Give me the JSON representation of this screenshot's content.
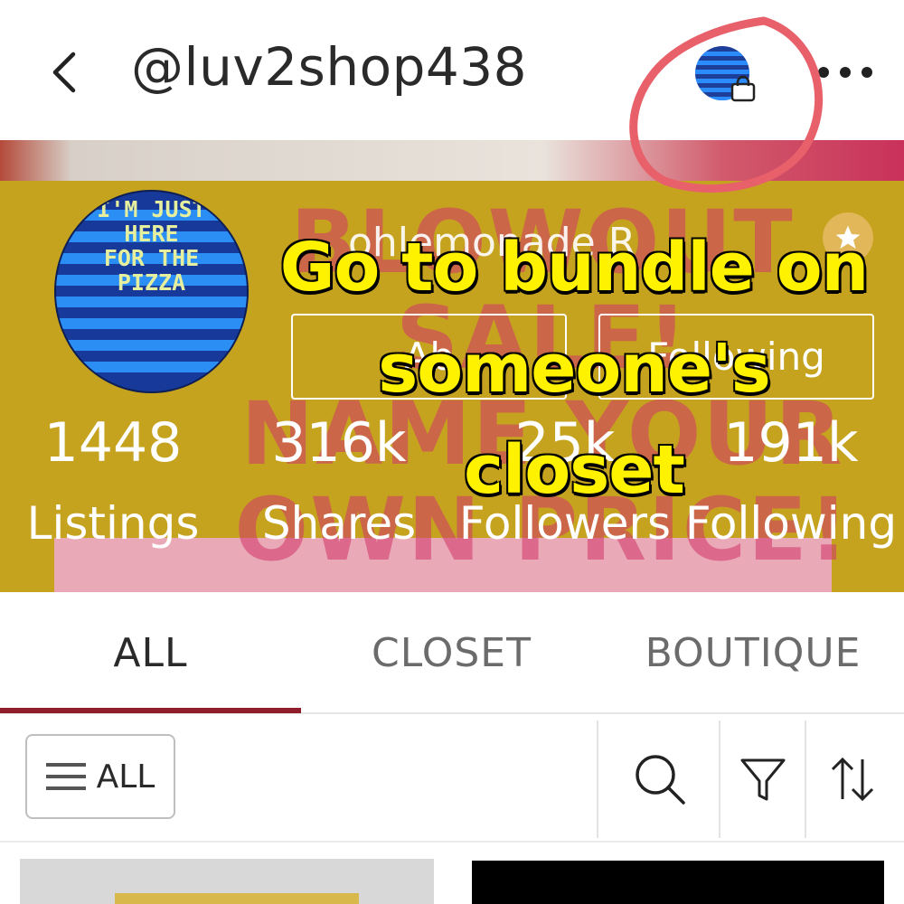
{
  "header": {
    "username": "@luv2shop438",
    "bundle_avatar_text": "I'M JUST HERE FOR THE PIZZA",
    "icons": {
      "back": "chevron-left-icon",
      "bag": "shopping-bag-icon",
      "more": "more-horizontal-icon"
    }
  },
  "banner": {
    "title_lines": [
      "BLOWOUT SALE!",
      "NAME YOUR",
      "OWN PRICE!"
    ],
    "avatar_text": [
      "I'M JUST",
      "HERE",
      "FOR THE",
      "PIZZA"
    ],
    "display_name": "ohlemonade R",
    "left_button_label": "Ab",
    "right_button_label": "Following",
    "star_icon": "star-icon"
  },
  "stats": [
    {
      "value": "1448",
      "label": "Listings"
    },
    {
      "value": "316k",
      "label": "Shares"
    },
    {
      "value": "25k",
      "label": "Followers"
    },
    {
      "value": "191k",
      "label": "Following"
    }
  ],
  "overlay": {
    "caption_lines": [
      "Go to bundle on",
      "someone's",
      "closet"
    ],
    "annotation_color": "#e8616a",
    "caption_color": "#fff200"
  },
  "tabs": [
    {
      "label": "ALL",
      "active": true
    },
    {
      "label": "CLOSET",
      "active": false
    },
    {
      "label": "BOUTIQUE",
      "active": false
    }
  ],
  "filter_bar": {
    "all_filter_label": "ALL",
    "icons": [
      "menu-icon",
      "search-icon",
      "filter-icon",
      "sort-icon"
    ]
  },
  "colors": {
    "accent": "#8f1d2a",
    "banner_bg": "#c6a31f",
    "avatar_blue": "#173a9a"
  }
}
